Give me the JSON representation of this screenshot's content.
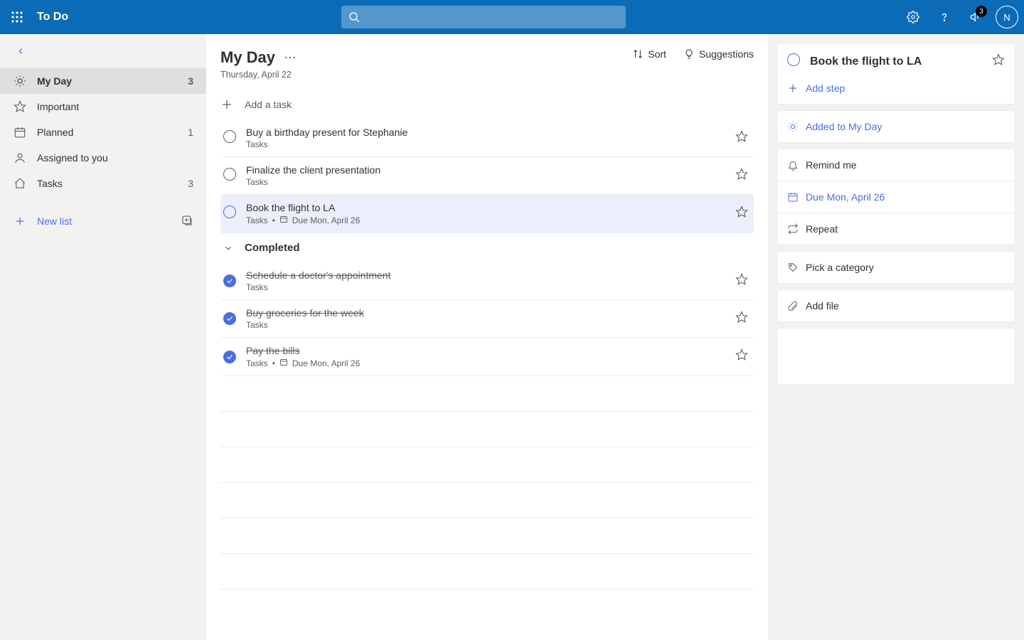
{
  "header": {
    "app_name": "To Do",
    "search_placeholder": "",
    "notification_count": "3",
    "avatar_initial": "N"
  },
  "sidebar": {
    "items": [
      {
        "label": "My Day",
        "icon": "sun",
        "count": "3",
        "active": true
      },
      {
        "label": "Important",
        "icon": "star",
        "count": "",
        "active": false
      },
      {
        "label": "Planned",
        "icon": "calendar",
        "count": "1",
        "active": false
      },
      {
        "label": "Assigned to you",
        "icon": "person",
        "count": "",
        "active": false
      },
      {
        "label": "Tasks",
        "icon": "home",
        "count": "3",
        "active": false
      }
    ],
    "new_list_label": "New list"
  },
  "main": {
    "title": "My Day",
    "subtitle": "Thursday, April 22",
    "sort_label": "Sort",
    "suggestions_label": "Suggestions",
    "add_task_placeholder": "Add a task",
    "completed_header": "Completed",
    "tasks_label": "Tasks",
    "due_prefix": "Due ",
    "tasks": [
      {
        "title": "Buy a birthday present for Stephanie",
        "list": "Tasks",
        "due": "",
        "selected": false
      },
      {
        "title": "Finalize the client presentation",
        "list": "Tasks",
        "due": "",
        "selected": false
      },
      {
        "title": "Book the flight to LA",
        "list": "Tasks",
        "due": "Mon, April 26",
        "selected": true
      }
    ],
    "completed": [
      {
        "title": "Schedule a doctor's appointment",
        "list": "Tasks",
        "due": ""
      },
      {
        "title": "Buy groceries for the week",
        "list": "Tasks",
        "due": ""
      },
      {
        "title": "Pay the bills",
        "list": "Tasks",
        "due": "Mon, April 26"
      }
    ]
  },
  "detail": {
    "title": "Book the flight to LA",
    "add_step_label": "Add step",
    "added_myday_label": "Added to My Day",
    "remind_label": "Remind me",
    "due_label": "Due Mon, April 26",
    "repeat_label": "Repeat",
    "category_label": "Pick a category",
    "addfile_label": "Add file"
  }
}
